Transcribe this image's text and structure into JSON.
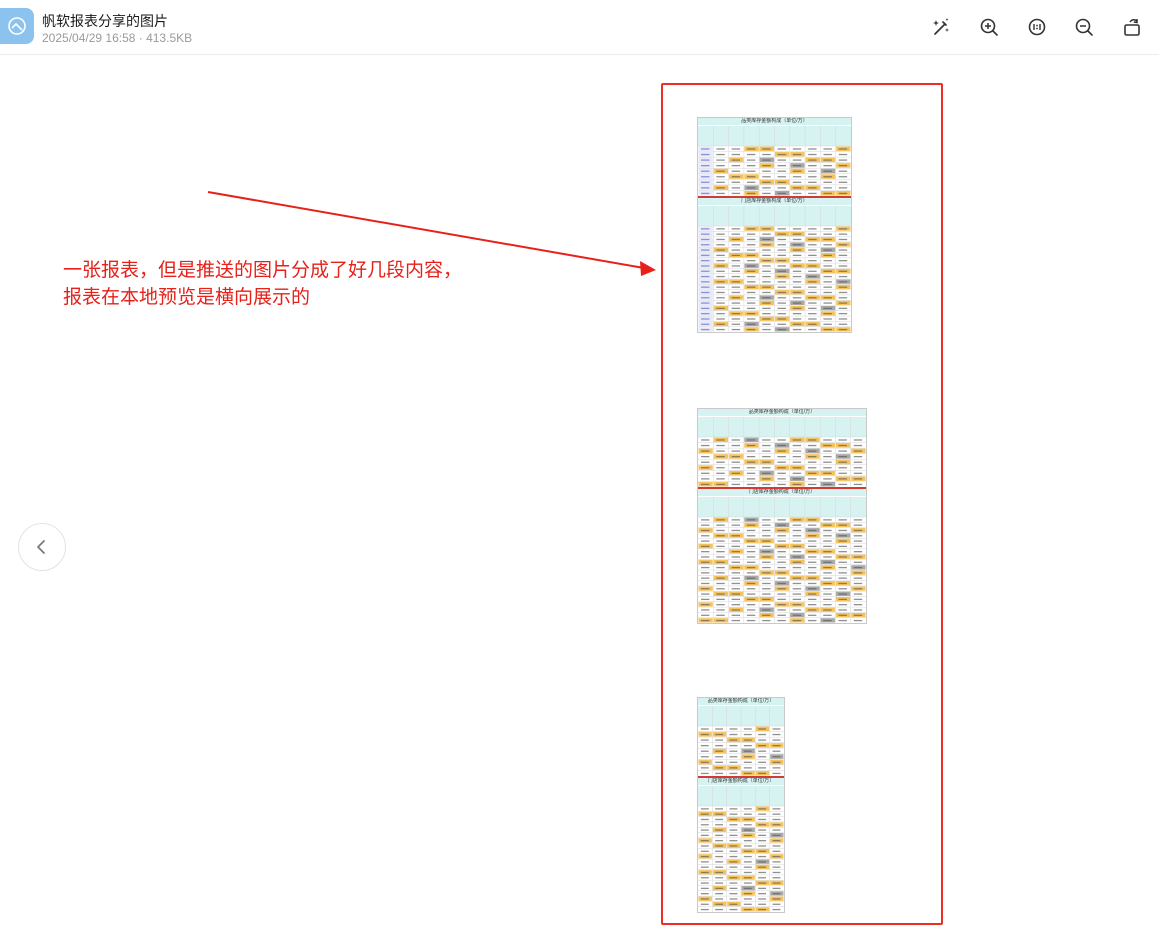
{
  "header": {
    "title": "帆软报表分享的图片",
    "meta": "2025/04/29 16:58 · 413.5KB"
  },
  "toolbar": {
    "icons": [
      "magic-wand-icon",
      "zoom-in-icon",
      "fit-original-icon",
      "zoom-out-icon",
      "rotate-icon"
    ]
  },
  "annotation": {
    "line1": "一张报表，但是推送的图片分成了好几段内容，",
    "line2": "报表在本地预览是横向展示的"
  },
  "colors": {
    "annotation": "#e8201a",
    "box": "#ee2d24",
    "header_cell": "#d6f3f1",
    "highlight_cell": "#f6c35a",
    "gray_cell": "#a8a8a8",
    "divider": "#d23b35"
  },
  "segments": [
    {
      "title_top": "品类库存金额构成（单位/万）",
      "title_bottom": "门店库存金额构成（单位/万）"
    },
    {
      "title_top": "品类库存金额构成（单位/万）",
      "title_bottom": "门店库存金额构成（单位/万）"
    },
    {
      "title_top": "品类库存金额构成（单位/万）",
      "title_bottom": "门店库存金额构成（单位/万）"
    }
  ]
}
